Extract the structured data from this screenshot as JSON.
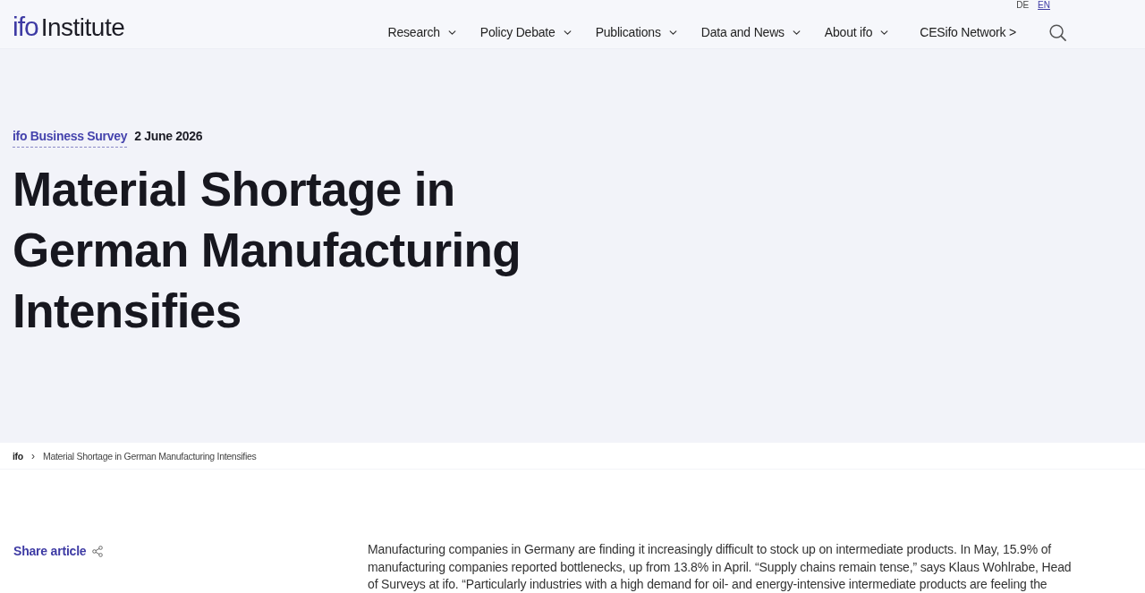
{
  "header": {
    "logo": {
      "mark": "ifo",
      "name": "Institute"
    },
    "languages": [
      {
        "label": "DE",
        "selected": false
      },
      {
        "label": "EN",
        "selected": true
      }
    ],
    "nav": [
      {
        "label": "Research",
        "kind": "dropdown"
      },
      {
        "label": "Policy Debate",
        "kind": "dropdown"
      },
      {
        "label": "Publications",
        "kind": "dropdown"
      },
      {
        "label": "Data and News",
        "kind": "dropdown"
      },
      {
        "label": "About ifo",
        "kind": "dropdown"
      },
      {
        "label": "CESifo Network >",
        "kind": "link"
      }
    ]
  },
  "hero": {
    "category": "ifo Business Survey",
    "date": "2 June 2026",
    "title": "Material Shortage in German Manufacturing Intensifies"
  },
  "breadcrumb": {
    "separator": "›",
    "items": [
      {
        "label": "ifo",
        "kind": "link"
      },
      {
        "label": "Material Shortage in German Manufacturing Intensifies",
        "kind": "current"
      }
    ]
  },
  "article": {
    "share_label": "Share article",
    "paragraph": "Manufacturing companies in Germany are finding it increasingly difficult to stock up on intermediate products. In May, 15.9% of manufacturing companies reported bottlenecks, up from 13.8% in April. “Supply chains remain tense,” says Klaus Wohlrabe, Head of Surveys at ifo. “Particularly industries with a high demand for oil- and energy-intensive intermediate products are feeling the"
  }
}
